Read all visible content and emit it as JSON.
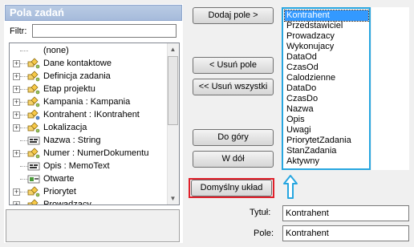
{
  "panel": {
    "title": "Pola zadań",
    "filter_label": "Filtr:",
    "filter_value": ""
  },
  "tree": {
    "items": [
      {
        "label": "(none)",
        "expander": false,
        "icon": "none-icon"
      },
      {
        "label": "Dane kontaktowe",
        "expander": true,
        "icon": "object-field-icon"
      },
      {
        "label": "Definicja zadania",
        "expander": true,
        "icon": "object-field-icon"
      },
      {
        "label": "Etap projektu",
        "expander": true,
        "icon": "object-field-icon"
      },
      {
        "label": "Kampania : Kampania",
        "expander": true,
        "icon": "object-field-icon"
      },
      {
        "label": "Kontrahent : IKontrahent",
        "expander": true,
        "icon": "interface-field-icon"
      },
      {
        "label": "Lokalizacja",
        "expander": true,
        "icon": "object-field-icon"
      },
      {
        "label": "Nazwa : String",
        "expander": false,
        "icon": "string-field-icon"
      },
      {
        "label": "Numer : NumerDokumentu",
        "expander": true,
        "icon": "object-field-icon"
      },
      {
        "label": "Opis : MemoText",
        "expander": false,
        "icon": "string-field-icon"
      },
      {
        "label": "Otwarte",
        "expander": false,
        "icon": "bool-field-icon"
      },
      {
        "label": "Priorytet",
        "expander": true,
        "icon": "object-field-icon"
      },
      {
        "label": "Prowadzacy",
        "expander": true,
        "icon": "object-field-icon"
      }
    ]
  },
  "buttons": {
    "add": "Dodaj pole >",
    "remove": "< Usuń pole",
    "remove_all": "<< Usuń wszystki",
    "up": "Do góry",
    "down": "W dół",
    "default_layout": "Domyślny układ"
  },
  "fields": {
    "selected_index": 0,
    "items": [
      "Kontrahent",
      "Przedstawiciel",
      "Prowadzacy",
      "Wykonujacy",
      "DataOd",
      "CzasOd",
      "Calodzienne",
      "DataDo",
      "CzasDo",
      "Nazwa",
      "Opis",
      "Uwagi",
      "PriorytetZadania",
      "StanZadania",
      "Aktywny"
    ]
  },
  "form": {
    "title_label": "Tytuł:",
    "title_value": "Kontrahent",
    "field_label": "Pole:",
    "field_value": "Kontrahent"
  },
  "colors": {
    "selection": "#3399ff",
    "highlight_frame": "#e0202a",
    "list_border": "#27a6e0"
  }
}
